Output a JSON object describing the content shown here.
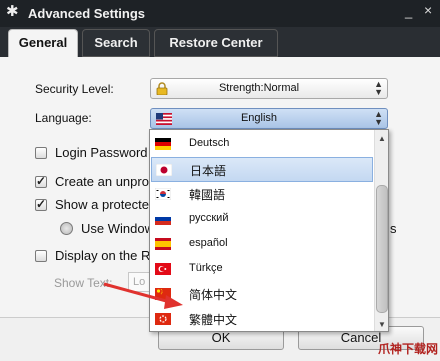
{
  "window": {
    "title": "Advanced Settings",
    "minimize": "_",
    "close": "×"
  },
  "tabs": [
    {
      "label": "General",
      "active": true
    },
    {
      "label": "Search",
      "active": false
    },
    {
      "label": "Restore Center",
      "active": false
    }
  ],
  "general": {
    "security_label": "Security Level:",
    "security_value": "Strength:Normal",
    "language_label": "Language:",
    "language_value": "English",
    "login_password": "Login Password",
    "create_unprot": "Create an unprot",
    "show_protected": "Show a protecte",
    "use_windows": "Use Window",
    "display_on": "Display on the Ri",
    "show_text_label": "Show Text:",
    "show_text_value": "Lo",
    "right_fragment": "s"
  },
  "dropdown": {
    "items": [
      {
        "label": "Deutsch",
        "flag": "germany"
      },
      {
        "label": "日本語",
        "flag": "japan",
        "selected": true
      },
      {
        "label": "韓國語",
        "flag": "korea"
      },
      {
        "label": "русский",
        "flag": "russia"
      },
      {
        "label": "español",
        "flag": "spain"
      },
      {
        "label": "Türkçe",
        "flag": "turkey"
      },
      {
        "label": "简体中文",
        "flag": "china"
      },
      {
        "label": "繁體中文",
        "flag": "hong-kong"
      }
    ]
  },
  "buttons": {
    "ok": "OK",
    "cancel": "Cancel"
  },
  "watermark": "爪神下载网",
  "colors": {
    "titlebar": "#1e2226",
    "panel": "#f4f4f4",
    "annotation_arrow": "#e0322e",
    "selection": "#c4d8f1"
  }
}
